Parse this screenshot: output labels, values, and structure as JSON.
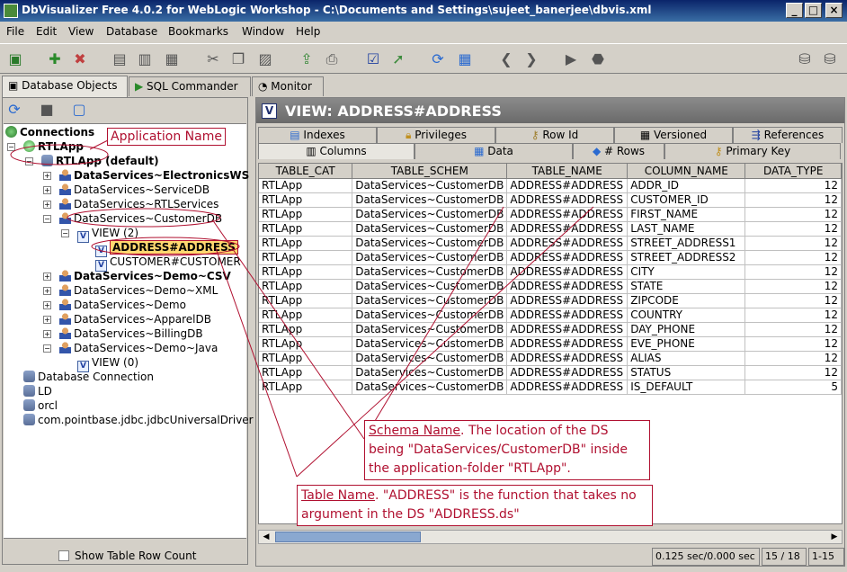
{
  "window": {
    "title": "DbVisualizer Free 4.0.2 for WebLogic Workshop - C:\\Documents and Settings\\sujeet_banerjee\\dbvis.xml"
  },
  "menu": [
    "File",
    "Edit",
    "View",
    "Database",
    "Bookmarks",
    "Window",
    "Help"
  ],
  "left_tabs": [
    "Database Objects",
    "SQL Commander",
    "Monitor"
  ],
  "tree": {
    "root": "Connections",
    "app": "RTLApp",
    "app_default": "RTLApp (default)",
    "ds": [
      "DataServices~ElectronicsWS",
      "DataServices~ServiceDB",
      "DataServices~RTLServices",
      "DataServices~CustomerDB"
    ],
    "view_group": "VIEW (2)",
    "views": [
      "ADDRESS#ADDRESS",
      "CUSTOMER#CUSTOMER"
    ],
    "ds2": [
      "DataServices~Demo~CSV",
      "DataServices~Demo~XML",
      "DataServices~Demo",
      "DataServices~ApparelDB",
      "DataServices~BillingDB",
      "DataServices~Demo~Java"
    ],
    "view_group2": "VIEW (0)",
    "conns": [
      "Database Connection",
      "LD",
      "orcl",
      "com.pointbase.jdbc.jdbcUniversalDriver"
    ],
    "show_row_count": "Show Table Row Count"
  },
  "view_title": "VIEW: ADDRESS#ADDRESS",
  "right_tabs_row1": [
    "Indexes",
    "Privileges",
    "Row Id",
    "Versioned",
    "References"
  ],
  "right_tabs_row2": [
    "Columns",
    "Data",
    "# Rows",
    "Primary Key"
  ],
  "table": {
    "headers": [
      "TABLE_CAT",
      "TABLE_SCHEM",
      "TABLE_NAME",
      "COLUMN_NAME",
      "DATA_TYPE"
    ],
    "rows": [
      [
        "RTLApp",
        "DataServices~CustomerDB",
        "ADDRESS#ADDRESS",
        "ADDR_ID",
        "12"
      ],
      [
        "RTLApp",
        "DataServices~CustomerDB",
        "ADDRESS#ADDRESS",
        "CUSTOMER_ID",
        "12"
      ],
      [
        "RTLApp",
        "DataServices~CustomerDB",
        "ADDRESS#ADDRESS",
        "FIRST_NAME",
        "12"
      ],
      [
        "RTLApp",
        "DataServices~CustomerDB",
        "ADDRESS#ADDRESS",
        "LAST_NAME",
        "12"
      ],
      [
        "RTLApp",
        "DataServices~CustomerDB",
        "ADDRESS#ADDRESS",
        "STREET_ADDRESS1",
        "12"
      ],
      [
        "RTLApp",
        "DataServices~CustomerDB",
        "ADDRESS#ADDRESS",
        "STREET_ADDRESS2",
        "12"
      ],
      [
        "RTLApp",
        "DataServices~CustomerDB",
        "ADDRESS#ADDRESS",
        "CITY",
        "12"
      ],
      [
        "RTLApp",
        "DataServices~CustomerDB",
        "ADDRESS#ADDRESS",
        "STATE",
        "12"
      ],
      [
        "RTLApp",
        "DataServices~CustomerDB",
        "ADDRESS#ADDRESS",
        "ZIPCODE",
        "12"
      ],
      [
        "RTLApp",
        "DataServices~CustomerDB",
        "ADDRESS#ADDRESS",
        "COUNTRY",
        "12"
      ],
      [
        "RTLApp",
        "DataServices~CustomerDB",
        "ADDRESS#ADDRESS",
        "DAY_PHONE",
        "12"
      ],
      [
        "RTLApp",
        "DataServices~CustomerDB",
        "ADDRESS#ADDRESS",
        "EVE_PHONE",
        "12"
      ],
      [
        "RTLApp",
        "DataServices~CustomerDB",
        "ADDRESS#ADDRESS",
        "ALIAS",
        "12"
      ],
      [
        "RTLApp",
        "DataServices~CustomerDB",
        "ADDRESS#ADDRESS",
        "STATUS",
        "12"
      ],
      [
        "RTLApp",
        "DataServices~CustomerDB",
        "ADDRESS#ADDRESS",
        "IS_DEFAULT",
        "5"
      ]
    ]
  },
  "status": {
    "time": "0.125 sec/0.000 sec",
    "position": "15 / 18",
    "range": "1-15"
  },
  "annotations": {
    "app_name": "Application Name",
    "schema_name_title": "Schema Name",
    "schema_name_text": ". The location of the DS being \"DataServices/CustomerDB\" inside the application-folder \"RTLApp\".",
    "table_name_title": "Table Name",
    "table_name_text": ". \"ADDRESS\" is the function that takes no argument in the DS \"ADDRESS.ds\""
  },
  "colors": {
    "annotation": "#b01030",
    "title_active": "#0a246a",
    "panel_title": "#6a6a6a"
  }
}
